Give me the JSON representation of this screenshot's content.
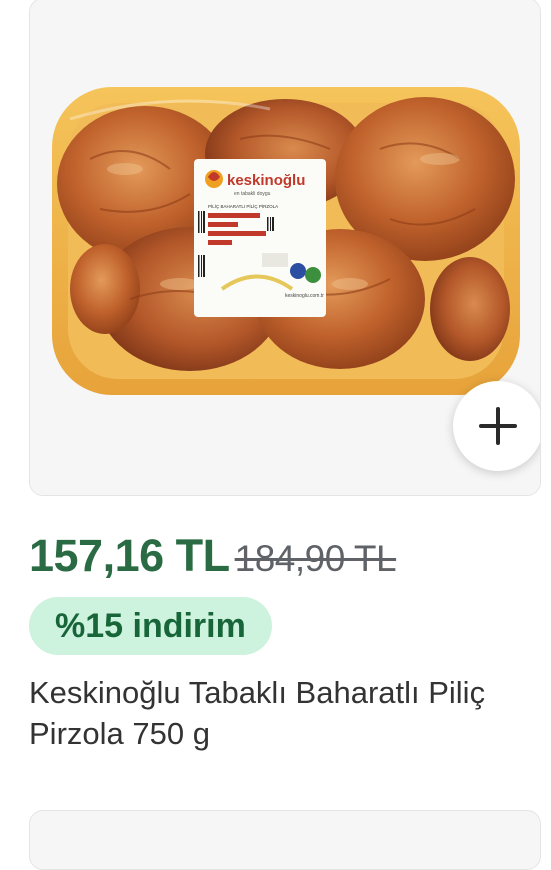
{
  "product": {
    "image": {
      "brand_label": "keskinoğlu",
      "label_tagline": "en tabakli doygu",
      "label_subtitle": "PİLİÇ BAHARATLI PİLİÇ PİRZOLA"
    },
    "add_icon": "plus-icon",
    "price_current": "157,16 TL",
    "price_old": "184,90 TL",
    "discount_label": "%15 indirim",
    "name": "Keskinoğlu Tabaklı Baharatlı Piliç Pirzola 750 g"
  },
  "colors": {
    "price_green": "#2a6b43",
    "badge_bg": "#cdf2de",
    "badge_text": "#176539"
  }
}
